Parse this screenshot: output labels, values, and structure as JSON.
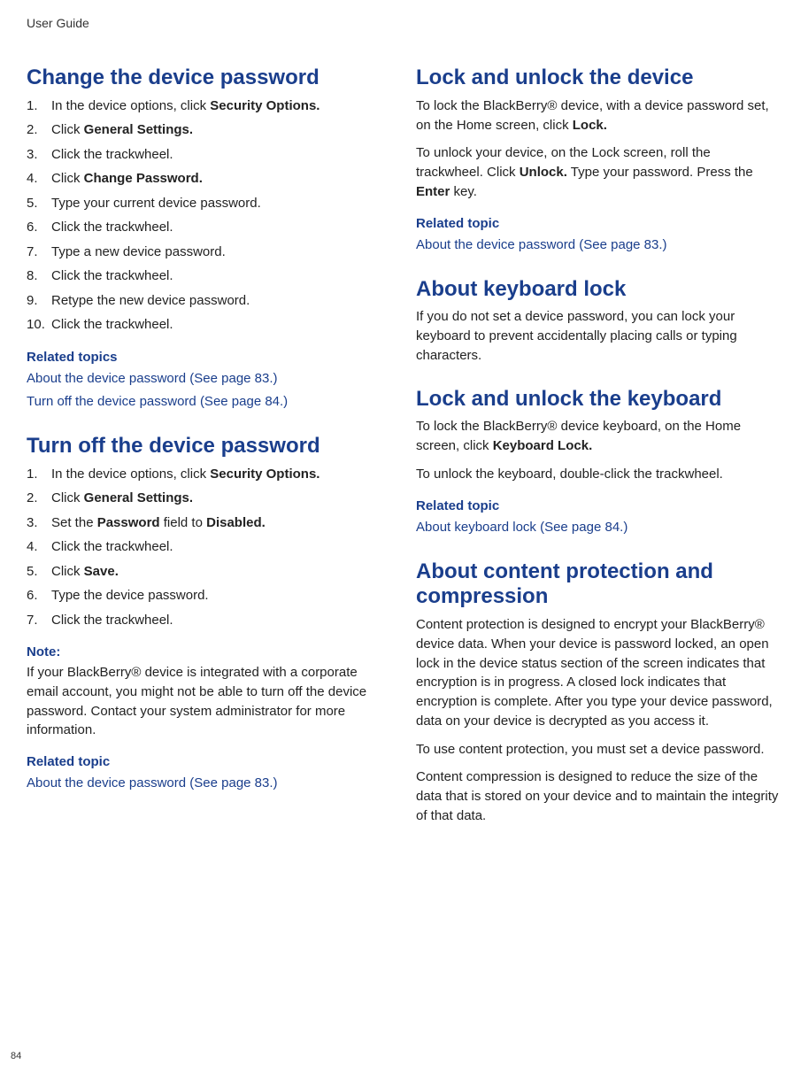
{
  "header": "User Guide",
  "pageNumber": "84",
  "left": {
    "section1": {
      "title": "Change the device password",
      "steps": [
        {
          "pre": "In the device options, click ",
          "bold": "Security Options."
        },
        {
          "pre": "Click ",
          "bold": "General Settings."
        },
        {
          "pre": "Click the trackwheel."
        },
        {
          "pre": "Click ",
          "bold": "Change Password."
        },
        {
          "pre": "Type your current device password."
        },
        {
          "pre": "Click the trackwheel."
        },
        {
          "pre": "Type a new device password."
        },
        {
          "pre": "Click the trackwheel."
        },
        {
          "pre": "Retype the new device password."
        },
        {
          "pre": "Click the trackwheel."
        }
      ],
      "relatedLabel": "Related topics",
      "links": [
        "About the device password (See page 83.)",
        "Turn off the device password (See page 84.)"
      ]
    },
    "section2": {
      "title": "Turn off the device password",
      "steps": [
        {
          "pre": "In the device options, click ",
          "bold": "Security Options."
        },
        {
          "pre": "Click ",
          "bold": "General Settings."
        },
        {
          "pre": "Set the ",
          "bold": "Password",
          "mid": " field to ",
          "bold2": "Disabled."
        },
        {
          "pre": "Click the trackwheel."
        },
        {
          "pre": "Click ",
          "bold": "Save."
        },
        {
          "pre": "Type the device password."
        },
        {
          "pre": "Click the trackwheel."
        }
      ],
      "noteLabel": "Note:",
      "noteBody": "If your BlackBerry® device is integrated with a corporate email account, you might not be able to turn off the device password. Contact your system administrator for more information.",
      "relatedLabel": "Related topic",
      "links": [
        "About the device password (See page 83.)"
      ]
    }
  },
  "right": {
    "section1": {
      "title": "Lock and unlock the device",
      "p1_pre": "To lock the BlackBerry® device, with a device password set, on the Home screen, click ",
      "p1_bold": "Lock.",
      "p2_pre": "To unlock your device, on the Lock screen, roll the trackwheel. Click ",
      "p2_bold": "Unlock.",
      "p2_mid": " Type your password. Press the ",
      "p2_bold2": "Enter",
      "p2_post": " key.",
      "relatedLabel": "Related topic",
      "links": [
        "About the device password (See page 83.)"
      ]
    },
    "section2": {
      "title": "About keyboard lock",
      "body": "If you do not set a device password, you can lock your keyboard to prevent accidentally placing calls or typing characters."
    },
    "section3": {
      "title": "Lock and unlock the keyboard",
      "p1_pre": "To lock the BlackBerry® device keyboard, on the Home screen, click ",
      "p1_bold": "Keyboard Lock.",
      "p2": "To unlock the keyboard, double-click the trackwheel.",
      "relatedLabel": "Related topic",
      "links": [
        "About keyboard lock (See page 84.)"
      ]
    },
    "section4": {
      "title": "About content protection and compression",
      "p1": "Content protection is designed to encrypt your BlackBerry® device data. When your device is password locked, an open lock in the device status section of the screen indicates that encryption is in progress. A closed lock indicates that encryption is complete. After you type your device password, data on your device is decrypted as you access it.",
      "p2": "To use content protection, you must set a device password.",
      "p3": "Content compression is designed to reduce the size of the data that is stored on your device and to maintain the integrity of that data."
    }
  }
}
